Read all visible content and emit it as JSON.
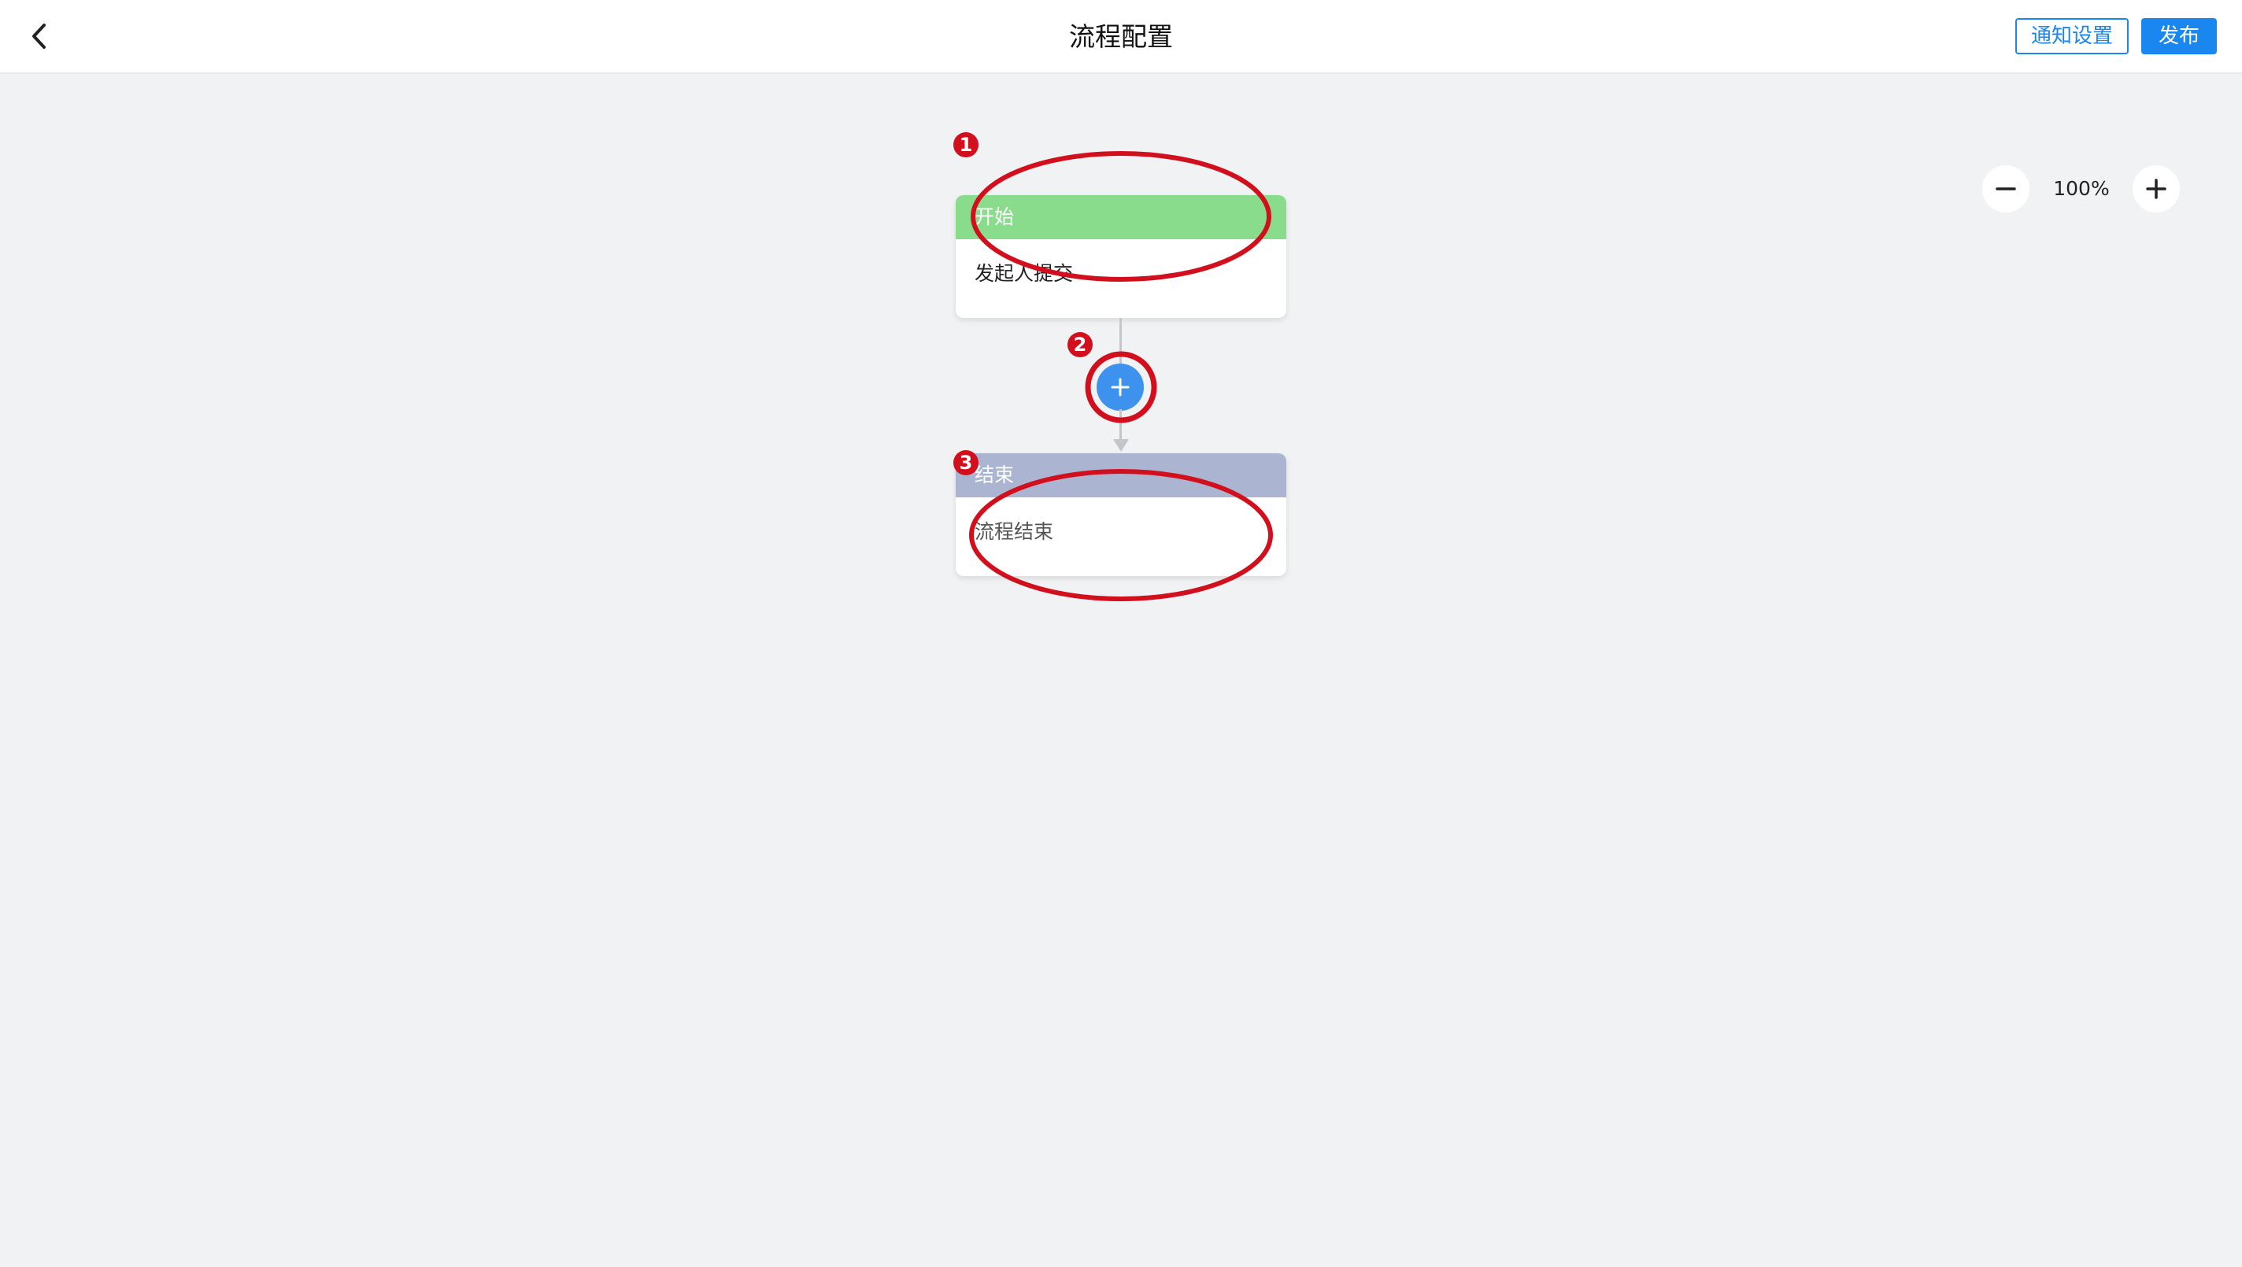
{
  "header": {
    "title": "流程配置",
    "back_icon": "chevron-left-icon",
    "notify_label": "通知设置",
    "publish_label": "发布"
  },
  "zoom": {
    "level": "100%",
    "out_icon": "minus-icon",
    "in_icon": "plus-icon"
  },
  "flow": {
    "start": {
      "title": "开始",
      "description": "发起人提交"
    },
    "add_icon": "plus-icon",
    "end": {
      "title": "结束",
      "description": "流程结束"
    }
  },
  "annotations": {
    "markers": [
      "1",
      "2",
      "3"
    ],
    "color": "#d20f1c"
  },
  "colors": {
    "accent": "#1a86f0",
    "start_header": "#8adc8d",
    "end_header": "#abb5d1",
    "add_button": "#3d92ee",
    "canvas": "#f1f2f4"
  }
}
